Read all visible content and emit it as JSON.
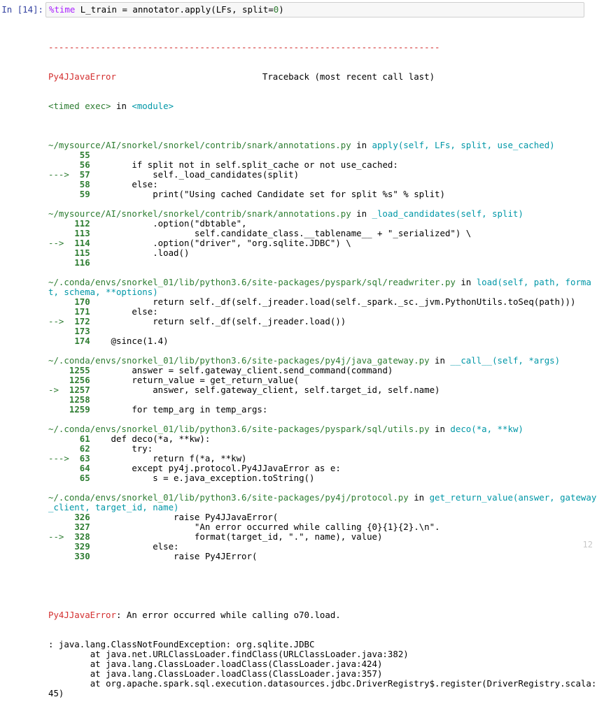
{
  "cell": {
    "prompt": "In [14]:",
    "code_magic": "%time",
    "code_rest": " L_train = annotator.apply(LFs, split=",
    "code_zero": "0",
    "code_end": ")"
  },
  "output": {
    "separator": "---------------------------------------------------------------------------",
    "error_name": "Py4JJavaError",
    "traceback_header": "                            Traceback (most recent call last)",
    "timed_exec": "<timed exec>",
    "in_module_in": " in ",
    "module": "<module>",
    "frames": [
      {
        "path": "~/mysource/AI/snorkel/snorkel/contrib/snark/annotations.py",
        "func": "apply(self, LFs, split, use_cached)",
        "func_wrap": "",
        "lines": [
          {
            "arrow": "    ",
            "num": " 55",
            "code": ""
          },
          {
            "arrow": "    ",
            "num": " 56",
            "code": "        if split not in self.split_cache or not use_cached:"
          },
          {
            "arrow": "--->",
            "num": " 57",
            "code": "            self._load_candidates(split)"
          },
          {
            "arrow": "    ",
            "num": " 58",
            "code": "        else:"
          },
          {
            "arrow": "    ",
            "num": " 59",
            "code": "            print(\"Using cached Candidate set for split %s\" % split)"
          }
        ]
      },
      {
        "path": "~/mysource/AI/snorkel/snorkel/contrib/snark/annotations.py",
        "func": "_load_candidates(self, split)",
        "func_wrap": "",
        "lines": [
          {
            "arrow": "    ",
            "num": "112",
            "code": "            .option(\"dbtable\","
          },
          {
            "arrow": "    ",
            "num": "113",
            "code": "                    self.candidate_class.__tablename__ + \"_serialized\") \\"
          },
          {
            "arrow": "--> ",
            "num": "114",
            "code": "            .option(\"driver\", \"org.sqlite.JDBC\") \\"
          },
          {
            "arrow": "    ",
            "num": "115",
            "code": "            .load()"
          },
          {
            "arrow": "    ",
            "num": "116",
            "code": ""
          }
        ]
      },
      {
        "path": "~/.conda/envs/snorkel_01/lib/python3.6/site-packages/pyspark/sql/readwriter.py",
        "func": "load(self, path, forma",
        "func_wrap": "t, schema, **options)",
        "lines": [
          {
            "arrow": "    ",
            "num": "170",
            "code": "            return self._df(self._jreader.load(self._spark._sc._jvm.PythonUtils.toSeq(path)))"
          },
          {
            "arrow": "    ",
            "num": "171",
            "code": "        else:"
          },
          {
            "arrow": "--> ",
            "num": "172",
            "code": "            return self._df(self._jreader.load())"
          },
          {
            "arrow": "    ",
            "num": "173",
            "code": ""
          },
          {
            "arrow": "    ",
            "num": "174",
            "code": "    @since(1.4)"
          }
        ]
      },
      {
        "path": "~/.conda/envs/snorkel_01/lib/python3.6/site-packages/py4j/java_gateway.py",
        "func": "__call__(self, *args)",
        "func_wrap": "",
        "lines": [
          {
            "arrow": "   ",
            "num": "1255",
            "code": "        answer = self.gateway_client.send_command(command)"
          },
          {
            "arrow": "   ",
            "num": "1256",
            "code": "        return_value = get_return_value("
          },
          {
            "arrow": "-> ",
            "num": "1257",
            "code": "            answer, self.gateway_client, self.target_id, self.name)"
          },
          {
            "arrow": "   ",
            "num": "1258",
            "code": ""
          },
          {
            "arrow": "   ",
            "num": "1259",
            "code": "        for temp_arg in temp_args:"
          }
        ]
      },
      {
        "path": "~/.conda/envs/snorkel_01/lib/python3.6/site-packages/pyspark/sql/utils.py",
        "func": "deco(*a, **kw)",
        "func_wrap": "",
        "lines": [
          {
            "arrow": "    ",
            "num": " 61",
            "code": "    def deco(*a, **kw):"
          },
          {
            "arrow": "    ",
            "num": " 62",
            "code": "        try:"
          },
          {
            "arrow": "--->",
            "num": " 63",
            "code": "            return f(*a, **kw)"
          },
          {
            "arrow": "    ",
            "num": " 64",
            "code": "        except py4j.protocol.Py4JJavaError as e:"
          },
          {
            "arrow": "    ",
            "num": " 65",
            "code": "            s = e.java_exception.toString()"
          }
        ]
      },
      {
        "path": "~/.conda/envs/snorkel_01/lib/python3.6/site-packages/py4j/protocol.py",
        "func": "get_return_value(answer, gateway",
        "func_wrap": "_client, target_id, name)",
        "lines": [
          {
            "arrow": "    ",
            "num": "326",
            "code": "                raise Py4JJavaError("
          },
          {
            "arrow": "    ",
            "num": "327",
            "code": "                    \"An error occurred while calling {0}{1}{2}.\\n\"."
          },
          {
            "arrow": "--> ",
            "num": "328",
            "code": "                    format(target_id, \".\", name), value)"
          },
          {
            "arrow": "    ",
            "num": "329",
            "code": "            else:"
          },
          {
            "arrow": "    ",
            "num": "330",
            "code": "                raise Py4JError("
          }
        ]
      }
    ],
    "final_error_name": "Py4JJavaError",
    "final_error_msg": ": An error occurred while calling o70.load.",
    "java_lines": [
      ": java.lang.ClassNotFoundException: org.sqlite.JDBC",
      "\tat java.net.URLClassLoader.findClass(URLClassLoader.java:382)",
      "\tat java.lang.ClassLoader.loadClass(ClassLoader.java:424)",
      "\tat java.lang.ClassLoader.loadClass(ClassLoader.java:357)",
      "\tat org.apache.spark.sql.execution.datasources.jdbc.DriverRegistry$.register(DriverRegistry.scala:",
      "45)"
    ]
  },
  "watermark": "12"
}
